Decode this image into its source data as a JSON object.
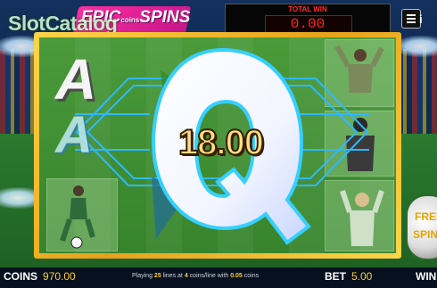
{
  "watermark": "SlotCatalog",
  "logo": {
    "word": "EPIC",
    "small": "coins",
    "big": "SPINS"
  },
  "total_win": {
    "label": "TOTAL WIN",
    "value": "0.00"
  },
  "menu_icon": "hamburger-menu-icon",
  "info_label": "i",
  "reel": {
    "symbol_a": "A",
    "win_amount": "18.00"
  },
  "free_spins_ball": {
    "line1": "FREE",
    "line2": "SPINS"
  },
  "bottom_bar": {
    "coins_label": "COINS",
    "coins_value": "970.00",
    "playing_prefix": "Playing",
    "lines": "25",
    "lines_text": "lines at",
    "coins_per_line": "4",
    "coins_per_line_text": "coins/line with",
    "coin_value": "0.05",
    "coin_text": "coins",
    "bet_label": "BET",
    "bet_value": "5.00",
    "win_label": "WIN"
  },
  "colors": {
    "frame": "#f2b82c",
    "win_text": "#ff2424",
    "accent_yellow": "#ffcc33",
    "logo_pink": "#e0208f"
  }
}
